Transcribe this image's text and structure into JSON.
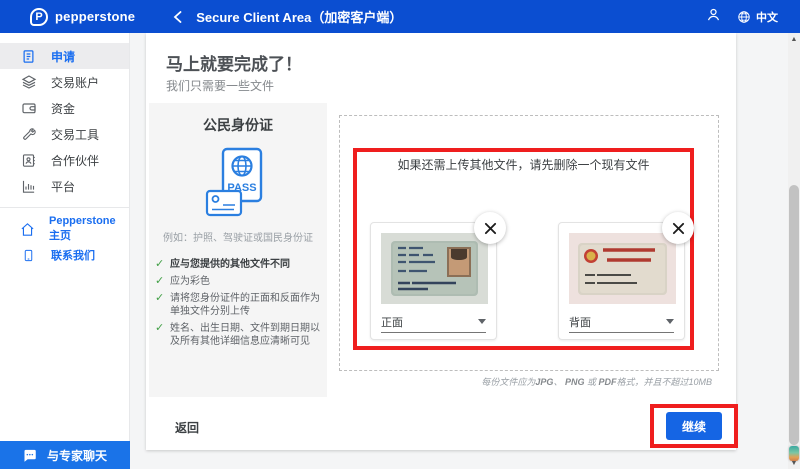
{
  "header": {
    "logo_letter": "P",
    "brand": "pepperstone",
    "title": "Secure Client Area（加密客户端）",
    "language_label": "中文"
  },
  "sidebar": {
    "items": [
      {
        "label": "申请",
        "icon": "application-document-icon",
        "active": true
      },
      {
        "label": "交易账户",
        "icon": "trading-accounts-layers-icon",
        "active": false
      },
      {
        "label": "资金",
        "icon": "funds-wallet-icon",
        "active": false
      },
      {
        "label": "交易工具",
        "icon": "trading-tools-wrench-icon",
        "active": false
      },
      {
        "label": "合作伙伴",
        "icon": "partners-contact-book-icon",
        "active": false
      },
      {
        "label": "平台",
        "icon": "platforms-chart-icon",
        "active": false
      }
    ],
    "links": [
      {
        "label": "Pepperstone 主页",
        "icon": "home-icon"
      },
      {
        "label": "联系我们",
        "icon": "contact-phone-icon"
      }
    ],
    "chat_label": "与专家聊天"
  },
  "main": {
    "title": "马上就要完成了！",
    "subtitle": "我们只需要一些文件",
    "document_panel": {
      "title": "公民身份证",
      "icon": "passport-pass-icon",
      "example": "例如：护照、驾驶证或国民身份证",
      "requirements": [
        "应与您提供的其他文件不同",
        "应为彩色",
        "请将您身份证件的正面和反面作为单独文件分别上传",
        "姓名、出生日期、文件到期日期以及所有其他详细信息应清晰可见"
      ]
    },
    "upload": {
      "message": "如果还需上传其他文件，请先删除一个现有文件",
      "files": [
        {
          "side_label": "正面",
          "image": "id-card-front-photo"
        },
        {
          "side_label": "背面",
          "image": "id-card-back-photo"
        }
      ],
      "note": {
        "p1": "每份文件应为",
        "f1": "JPG",
        "s1": "、 ",
        "f2": "PNG",
        "s2": " 或 ",
        "f3": "PDF",
        "p2": "格式，并且不超过10MB"
      }
    },
    "footer": {
      "back_label": "返回",
      "continue_label": "继续"
    }
  },
  "colors": {
    "header_blue": "#0b4ed1",
    "accent_blue": "#1a6ef0",
    "button_blue": "#1565e4",
    "chat_blue": "#1a73e8",
    "annotation_red": "#ef1e1e",
    "check_green": "#43a047"
  }
}
